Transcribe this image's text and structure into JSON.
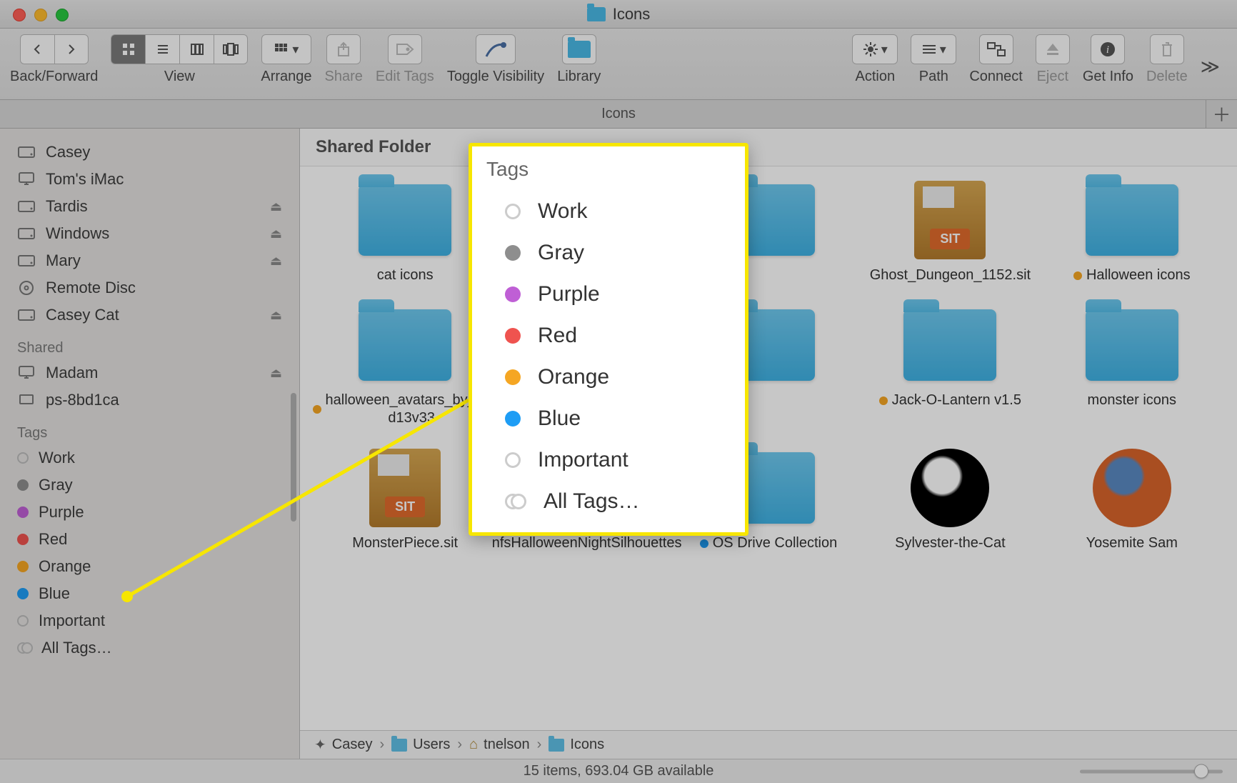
{
  "window": {
    "title": "Icons"
  },
  "toolbar": {
    "back_forward_label": "Back/Forward",
    "view_label": "View",
    "arrange_label": "Arrange",
    "share_label": "Share",
    "edit_tags_label": "Edit Tags",
    "toggle_visibility_label": "Toggle Visibility",
    "library_label": "Library",
    "action_label": "Action",
    "path_label": "Path",
    "connect_label": "Connect",
    "eject_label": "Eject",
    "get_info_label": "Get Info",
    "delete_label": "Delete"
  },
  "tab": {
    "title": "Icons"
  },
  "sidebar": {
    "devices": [
      {
        "name": "Casey",
        "icon": "hdd",
        "eject": false
      },
      {
        "name": "Tom's iMac",
        "icon": "imac",
        "eject": false
      },
      {
        "name": "Tardis",
        "icon": "hdd",
        "eject": true
      },
      {
        "name": "Windows",
        "icon": "hdd",
        "eject": true
      },
      {
        "name": "Mary",
        "icon": "hdd",
        "eject": true
      },
      {
        "name": "Remote Disc",
        "icon": "disc",
        "eject": false
      },
      {
        "name": "Casey Cat",
        "icon": "hdd",
        "eject": true
      }
    ],
    "shared_header": "Shared",
    "shared": [
      {
        "name": "Madam",
        "icon": "imac",
        "eject": true
      },
      {
        "name": "ps-8bd1ca",
        "icon": "display",
        "eject": false
      }
    ],
    "tags_header": "Tags",
    "tags": [
      {
        "name": "Work",
        "color": "none"
      },
      {
        "name": "Gray",
        "color": "#8e8e8e"
      },
      {
        "name": "Purple",
        "color": "#bf5fd5"
      },
      {
        "name": "Red",
        "color": "#ef534f"
      },
      {
        "name": "Orange",
        "color": "#f5a623"
      },
      {
        "name": "Blue",
        "color": "#1e9df5"
      },
      {
        "name": "Important",
        "color": "none"
      },
      {
        "name": "All Tags…",
        "color": "all"
      }
    ]
  },
  "content": {
    "header": "Shared Folder",
    "items": [
      {
        "name": "cat icons",
        "kind": "folder",
        "tag": null
      },
      {
        "name": "",
        "kind": "folder",
        "tag": null,
        "hidden": true
      },
      {
        "name": "",
        "kind": "folder",
        "tag": null,
        "hidden": true
      },
      {
        "name": "Ghost_Dungeon_1152.sit",
        "kind": "sit",
        "tag": null
      },
      {
        "name": "Halloween icons",
        "kind": "folder",
        "tag": "#f5a623"
      },
      {
        "name": "halloween_avatars_by_d…d13v33",
        "kind": "folder",
        "tag": "#f5a623"
      },
      {
        "name": "",
        "kind": "blank",
        "hidden": true
      },
      {
        "name": "",
        "kind": "folder",
        "tag": null,
        "hidden": true
      },
      {
        "name": "Jack-O-Lantern v1.5",
        "kind": "folder",
        "tag": "#f5a623"
      },
      {
        "name": "monster icons",
        "kind": "folder",
        "tag": null
      },
      {
        "name": "MonsterPiece.sit",
        "kind": "sit",
        "tag": null
      },
      {
        "name": "nfsHalloweenNightSilhouettes",
        "kind": "app",
        "tag": null
      },
      {
        "name": "OS Drive Collection",
        "kind": "folder",
        "tag": "#1e9df5"
      },
      {
        "name": "Sylvester-the-Cat",
        "kind": "char",
        "color1": "#000",
        "color2": "#fff"
      },
      {
        "name": "Yosemite Sam",
        "kind": "char",
        "color1": "#d9642b",
        "color2": "#5a89c2"
      }
    ]
  },
  "pathbar": {
    "segments": [
      {
        "label": "Casey",
        "icon": "root"
      },
      {
        "label": "Users",
        "icon": "folder"
      },
      {
        "label": "tnelson",
        "icon": "home"
      },
      {
        "label": "Icons",
        "icon": "folder"
      }
    ]
  },
  "status": {
    "text": "15 items, 693.04 GB available"
  },
  "popover": {
    "title": "Tags",
    "items": [
      {
        "name": "Work",
        "color": "none"
      },
      {
        "name": "Gray",
        "color": "#8e8e8e"
      },
      {
        "name": "Purple",
        "color": "#bf5fd5"
      },
      {
        "name": "Red",
        "color": "#ef534f"
      },
      {
        "name": "Orange",
        "color": "#f5a623"
      },
      {
        "name": "Blue",
        "color": "#1e9df5"
      },
      {
        "name": "Important",
        "color": "none"
      },
      {
        "name": "All Tags…",
        "color": "all"
      }
    ]
  }
}
